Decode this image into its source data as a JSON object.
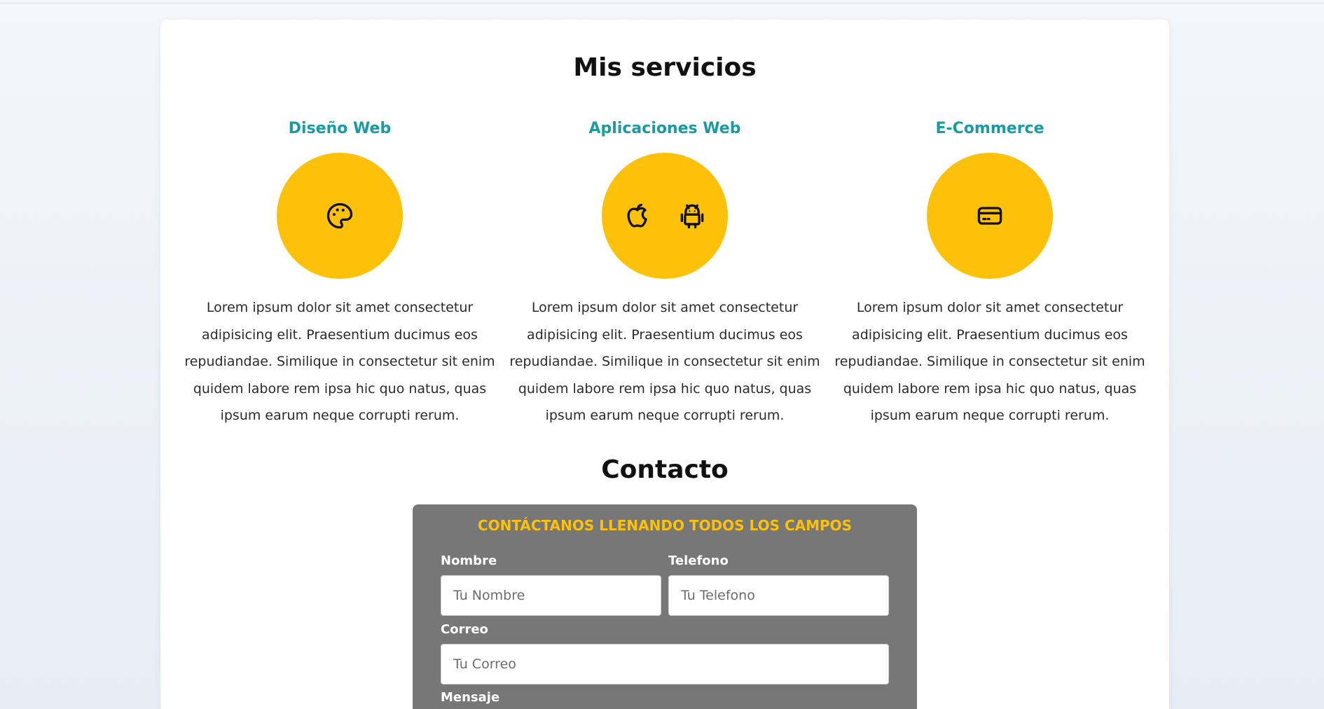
{
  "services": {
    "title": "Mis servicios",
    "items": [
      {
        "heading": "Diseño Web",
        "icons": [
          "palette-icon"
        ],
        "text": "Lorem ipsum dolor sit amet consectetur adipisicing elit. Praesentium ducimus eos repudiandae. Similique in consectetur sit enim quidem labore rem ipsa hic quo natus, quas ipsum earum neque corrupti rerum."
      },
      {
        "heading": "Aplicaciones Web",
        "icons": [
          "apple-icon",
          "android-icon"
        ],
        "text": "Lorem ipsum dolor sit amet consectetur adipisicing elit. Praesentium ducimus eos repudiandae. Similique in consectetur sit enim quidem labore rem ipsa hic quo natus, quas ipsum earum neque corrupti rerum."
      },
      {
        "heading": "E-Commerce",
        "icons": [
          "credit-card-icon"
        ],
        "text": "Lorem ipsum dolor sit amet consectetur adipisicing elit. Praesentium ducimus eos repudiandae. Similique in consectetur sit enim quidem labore rem ipsa hic quo natus, quas ipsum earum neque corrupti rerum."
      }
    ]
  },
  "contact": {
    "title": "Contacto",
    "form_heading": "CONTÁCTANOS LLENANDO TODOS LOS CAMPOS",
    "fields": {
      "nombre": {
        "label": "Nombre",
        "placeholder": "Tu Nombre",
        "value": ""
      },
      "telefono": {
        "label": "Telefono",
        "placeholder": "Tu Telefono",
        "value": ""
      },
      "correo": {
        "label": "Correo",
        "placeholder": "Tu Correo",
        "value": ""
      },
      "mensaje": {
        "label": "Mensaje"
      }
    }
  },
  "colors": {
    "accent": "#fdc10a",
    "service_heading": "#1a9aa3",
    "form_background": "#777777"
  }
}
